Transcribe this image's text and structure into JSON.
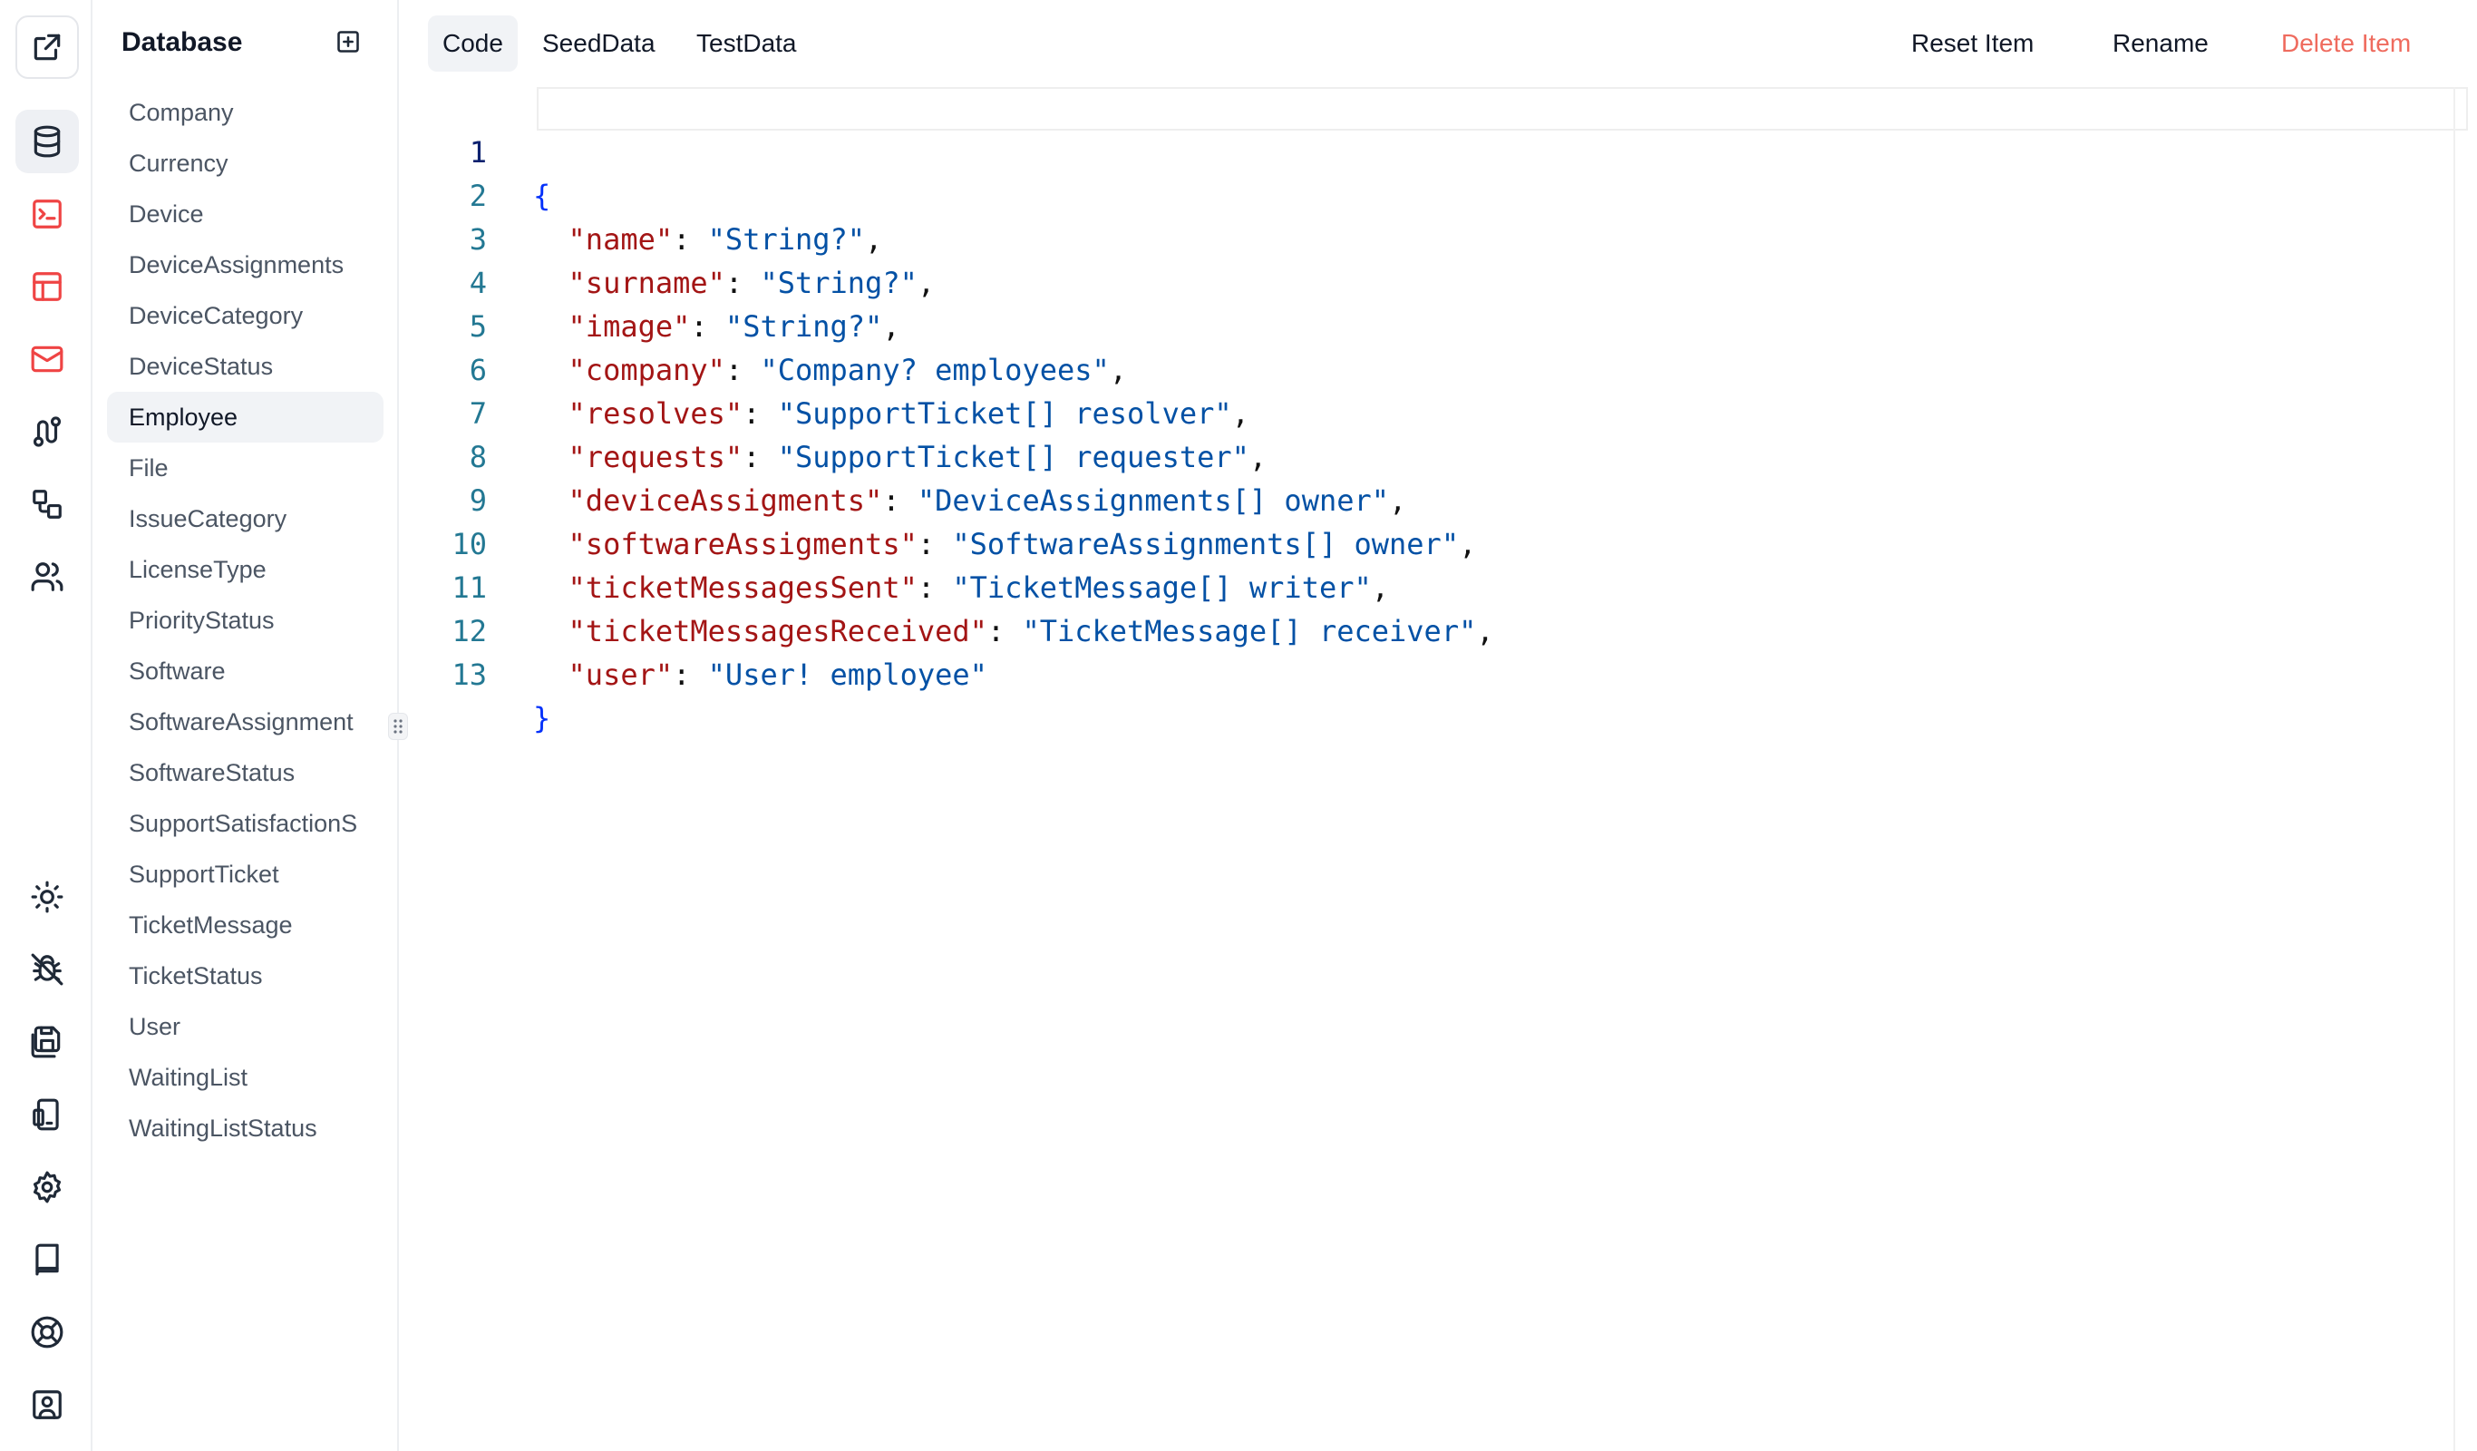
{
  "rail": {
    "top_icons": [
      "external-link-icon",
      "database-icon",
      "terminal-icon",
      "layout-icon",
      "mail-icon",
      "route-icon",
      "component-icon",
      "users-icon"
    ],
    "bottom_icons": [
      "sun-icon",
      "bug-off-icon",
      "save-all-icon",
      "device-icon",
      "settings-icon",
      "book-icon",
      "life-buoy-icon",
      "contact-icon"
    ],
    "active": "database-icon"
  },
  "sidebar": {
    "title": "Database",
    "add_icon": "plus-square-icon",
    "items": [
      {
        "label": "Company"
      },
      {
        "label": "Currency"
      },
      {
        "label": "Device"
      },
      {
        "label": "DeviceAssignments"
      },
      {
        "label": "DeviceCategory"
      },
      {
        "label": "DeviceStatus"
      },
      {
        "label": "Employee",
        "active": true
      },
      {
        "label": "File"
      },
      {
        "label": "IssueCategory"
      },
      {
        "label": "LicenseType"
      },
      {
        "label": "PriorityStatus"
      },
      {
        "label": "Software"
      },
      {
        "label": "SoftwareAssignment"
      },
      {
        "label": "SoftwareStatus"
      },
      {
        "label": "SupportSatisfactionS"
      },
      {
        "label": "SupportTicket"
      },
      {
        "label": "TicketMessage"
      },
      {
        "label": "TicketStatus"
      },
      {
        "label": "User"
      },
      {
        "label": "WaitingList"
      },
      {
        "label": "WaitingListStatus"
      }
    ]
  },
  "toolbar": {
    "tabs": [
      {
        "label": "Code",
        "active": true
      },
      {
        "label": "SeedData"
      },
      {
        "label": "TestData"
      }
    ],
    "actions": {
      "reset": "Reset Item",
      "rename": "Rename",
      "delete": "Delete Item"
    }
  },
  "editor": {
    "current_line": 1,
    "lines": [
      {
        "num": "1",
        "open": "{"
      },
      {
        "num": "2",
        "key": "\"name\"",
        "value": "\"String?\"",
        "comma": true
      },
      {
        "num": "3",
        "key": "\"surname\"",
        "value": "\"String?\"",
        "comma": true
      },
      {
        "num": "4",
        "key": "\"image\"",
        "value": "\"String?\"",
        "comma": true
      },
      {
        "num": "5",
        "key": "\"company\"",
        "value": "\"Company? employees\"",
        "comma": true
      },
      {
        "num": "6",
        "key": "\"resolves\"",
        "value": "\"SupportTicket[] resolver\"",
        "comma": true
      },
      {
        "num": "7",
        "key": "\"requests\"",
        "value": "\"SupportTicket[] requester\"",
        "comma": true
      },
      {
        "num": "8",
        "key": "\"deviceAssigments\"",
        "value": "\"DeviceAssignments[] owner\"",
        "comma": true
      },
      {
        "num": "9",
        "key": "\"softwareAssigments\"",
        "value": "\"SoftwareAssignments[] owner\"",
        "comma": true
      },
      {
        "num": "10",
        "key": "\"ticketMessagesSent\"",
        "value": "\"TicketMessage[] writer\"",
        "comma": true
      },
      {
        "num": "11",
        "key": "\"ticketMessagesReceived\"",
        "value": "\"TicketMessage[] receiver\"",
        "comma": true
      },
      {
        "num": "12",
        "key": "\"user\"",
        "value": "\"User! employee\"",
        "comma": false
      },
      {
        "num": "13",
        "close": "}"
      }
    ]
  }
}
